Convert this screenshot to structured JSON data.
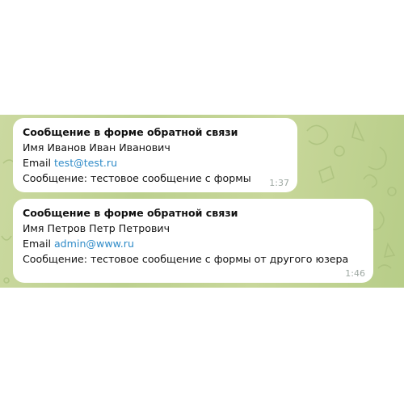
{
  "messages": [
    {
      "title": "Сообщение в форме обратной связи",
      "name_line": "Имя Иванов Иван Иванович",
      "email_label": "Email",
      "email_value": "test@test.ru",
      "message_line": "Сообщение: тестовое сообщение с формы",
      "time": "1:37"
    },
    {
      "title": "Сообщение в форме обратной связи",
      "name_line": "Имя Петров Петр Петрович",
      "email_label": "Email",
      "email_value": "admin@www.ru",
      "message_line": "Сообщение: тестовое сообщение с формы от другого юзера",
      "time": "1:46"
    }
  ],
  "colors": {
    "chat_background": "#bfd28f",
    "bubble": "#ffffff",
    "link": "#2f8bc8",
    "timestamp": "#9ea8a2"
  },
  "icons": [
    "doodle-pattern-icon"
  ]
}
